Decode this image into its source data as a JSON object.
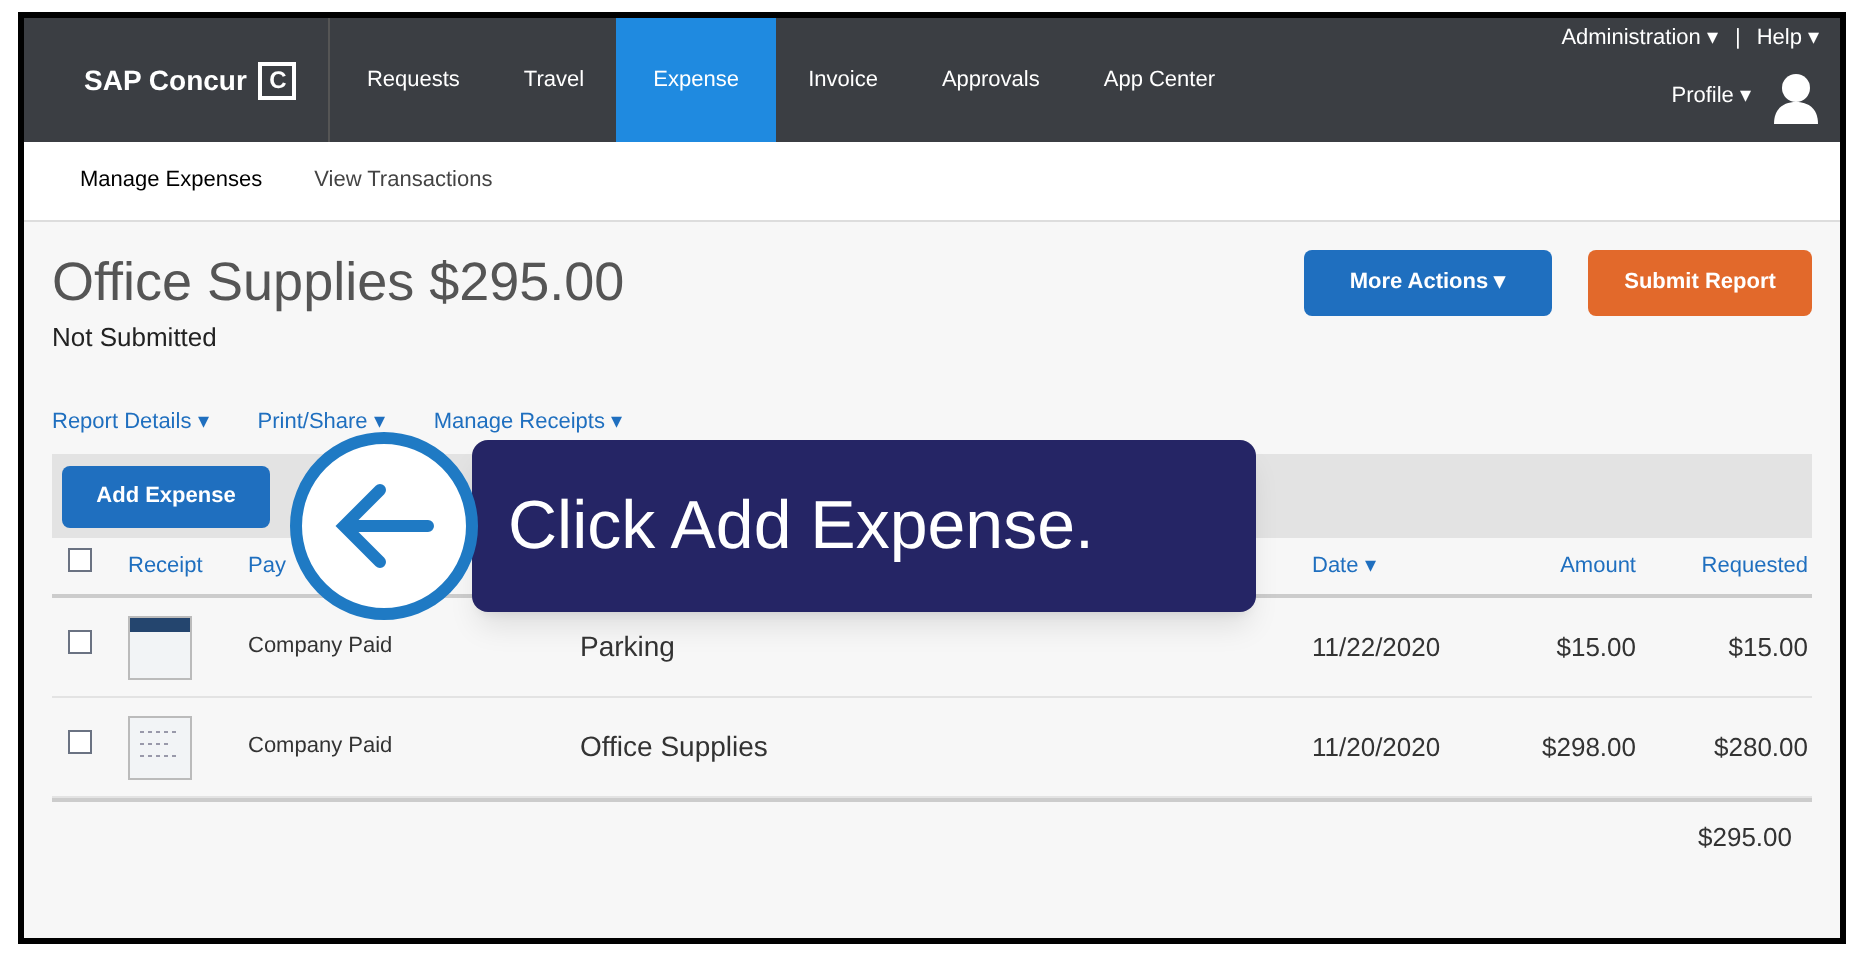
{
  "nav": {
    "logo": "SAP Concur",
    "logo_mark": "C",
    "items": [
      {
        "label": "Requests",
        "selected": false
      },
      {
        "label": "Travel",
        "selected": false
      },
      {
        "label": "Expense",
        "selected": true
      },
      {
        "label": "Invoice",
        "selected": false
      },
      {
        "label": "Approvals",
        "selected": false
      },
      {
        "label": "App Center",
        "selected": false
      }
    ],
    "top_links": [
      "Administration ▾",
      "|",
      "Help ▾"
    ],
    "profile": "Profile ▾"
  },
  "subnav": [
    {
      "label": "Manage Expenses",
      "selected": true
    },
    {
      "label": "View Transactions",
      "selected": false
    }
  ],
  "report": {
    "title": "Office Supplies $295.00",
    "status": "Not Submitted",
    "more_actions": "More Actions ▾",
    "submit": "Submit Report"
  },
  "report_links": [
    "Report Details ▾",
    "Print/Share ▾",
    "Manage Receipts ▾"
  ],
  "add_expense": "Add Expense",
  "table": {
    "select_all_checked": false,
    "columns": [
      "Receipt",
      "Pay",
      "Date ▾",
      "Amount",
      "Requested"
    ],
    "rows": [
      {
        "checked": false,
        "payment": "Company Paid",
        "type": "Parking",
        "date": "11/22/2020",
        "amount": "$15.00",
        "requested": "$15.00"
      },
      {
        "checked": false,
        "payment": "Company Paid",
        "type": "Office Supplies",
        "date": "11/20/2020",
        "amount": "$298.00",
        "requested": "$280.00"
      }
    ],
    "total": "$295.00"
  },
  "callout": {
    "text": "Click Add Expense."
  }
}
